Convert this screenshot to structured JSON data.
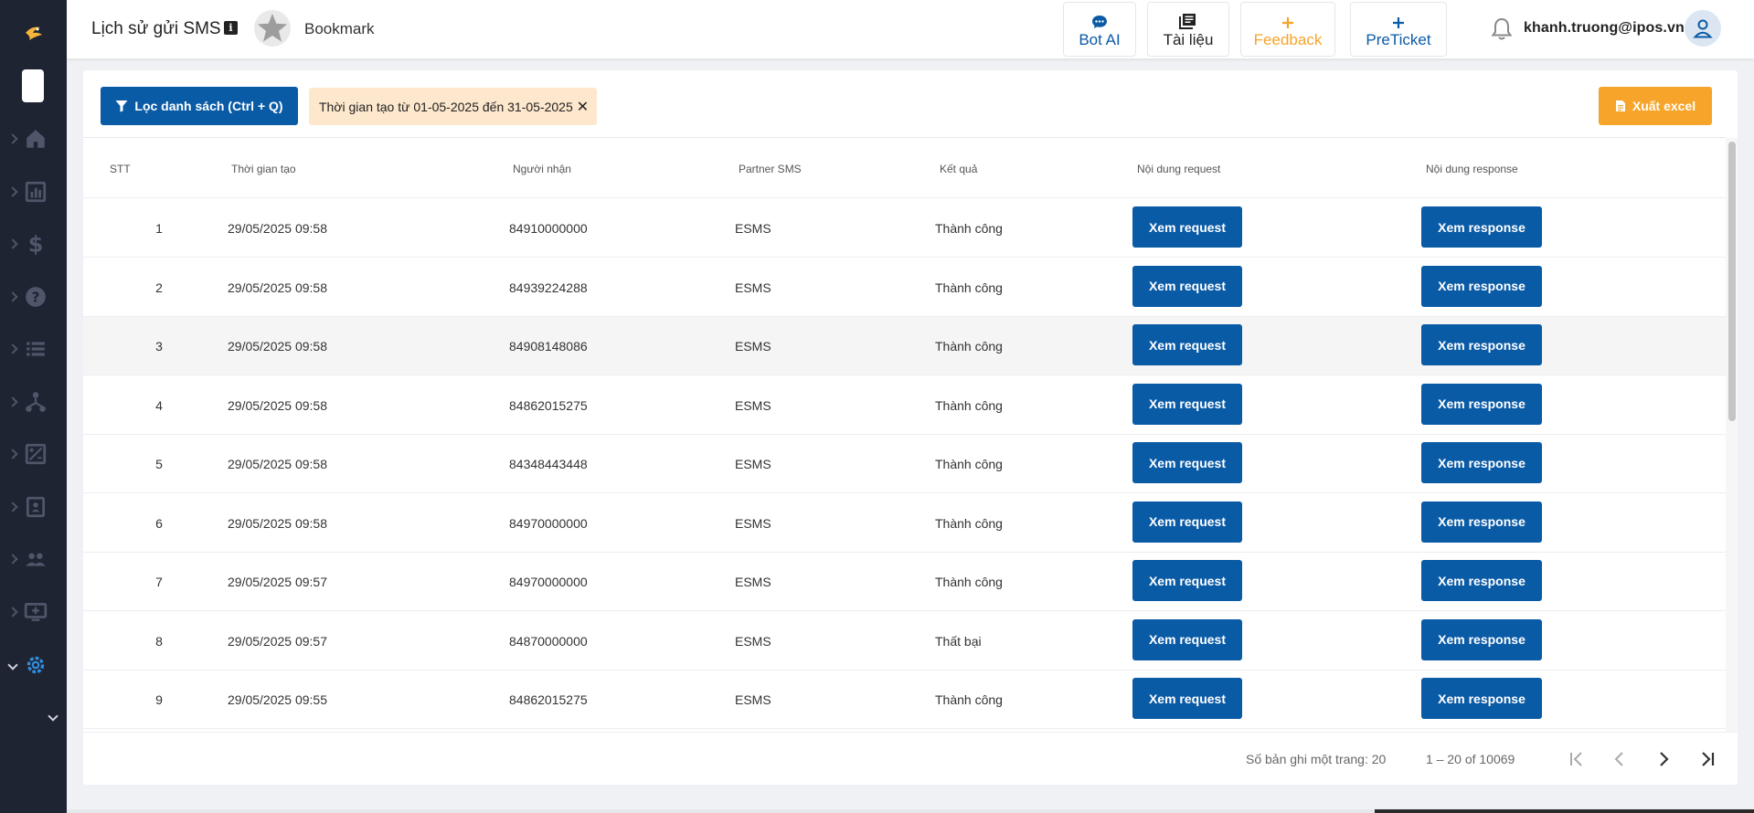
{
  "header": {
    "title": "Lịch sử gửi SMS",
    "bookmark": "Bookmark",
    "buttons": [
      {
        "label": "Bot AI",
        "color": "#0a5ba6"
      },
      {
        "label": "Tài liệu",
        "color": "#222222"
      },
      {
        "label": "Feedback",
        "color": "#f6a42a"
      },
      {
        "label": "PreTicket",
        "color": "#0a5ba6"
      }
    ],
    "user_email": "khanh.truong@ipos.vn"
  },
  "toolbar": {
    "filter_label": "Lọc danh sách (Ctrl + Q)",
    "chip_label": "Thời gian tạo từ 01-05-2025 đến 31-05-2025",
    "export_label": "Xuất excel"
  },
  "table": {
    "columns": [
      "STT",
      "Thời gian tạo",
      "Người nhận",
      "Partner SMS",
      "Kết quả",
      "Nội dung request",
      "Nội dung response"
    ],
    "request_btn": "Xem request",
    "response_btn": "Xem response",
    "rows": [
      {
        "stt": "1",
        "time": "29/05/2025 09:58",
        "recipient": "84910000000",
        "partner": "ESMS",
        "result": "Thành công"
      },
      {
        "stt": "2",
        "time": "29/05/2025 09:58",
        "recipient": "84939224288",
        "partner": "ESMS",
        "result": "Thành công"
      },
      {
        "stt": "3",
        "time": "29/05/2025 09:58",
        "recipient": "84908148086",
        "partner": "ESMS",
        "result": "Thành công"
      },
      {
        "stt": "4",
        "time": "29/05/2025 09:58",
        "recipient": "84862015275",
        "partner": "ESMS",
        "result": "Thành công"
      },
      {
        "stt": "5",
        "time": "29/05/2025 09:58",
        "recipient": "84348443448",
        "partner": "ESMS",
        "result": "Thành công"
      },
      {
        "stt": "6",
        "time": "29/05/2025 09:58",
        "recipient": "84970000000",
        "partner": "ESMS",
        "result": "Thành công"
      },
      {
        "stt": "7",
        "time": "29/05/2025 09:57",
        "recipient": "84970000000",
        "partner": "ESMS",
        "result": "Thành công"
      },
      {
        "stt": "8",
        "time": "29/05/2025 09:57",
        "recipient": "84870000000",
        "partner": "ESMS",
        "result": "Thất bại"
      },
      {
        "stt": "9",
        "time": "29/05/2025 09:55",
        "recipient": "84862015275",
        "partner": "ESMS",
        "result": "Thành công"
      }
    ]
  },
  "pagination": {
    "per_page": "Số bản ghi một trang: 20",
    "range": "1 – 20 of 10069"
  },
  "colors": {
    "primary": "#0a5ba6",
    "accent": "#f6a42a",
    "chip_bg": "#fde7cd",
    "sidebar_bg": "#1f2433",
    "active_icon": "#2f8fe0"
  }
}
